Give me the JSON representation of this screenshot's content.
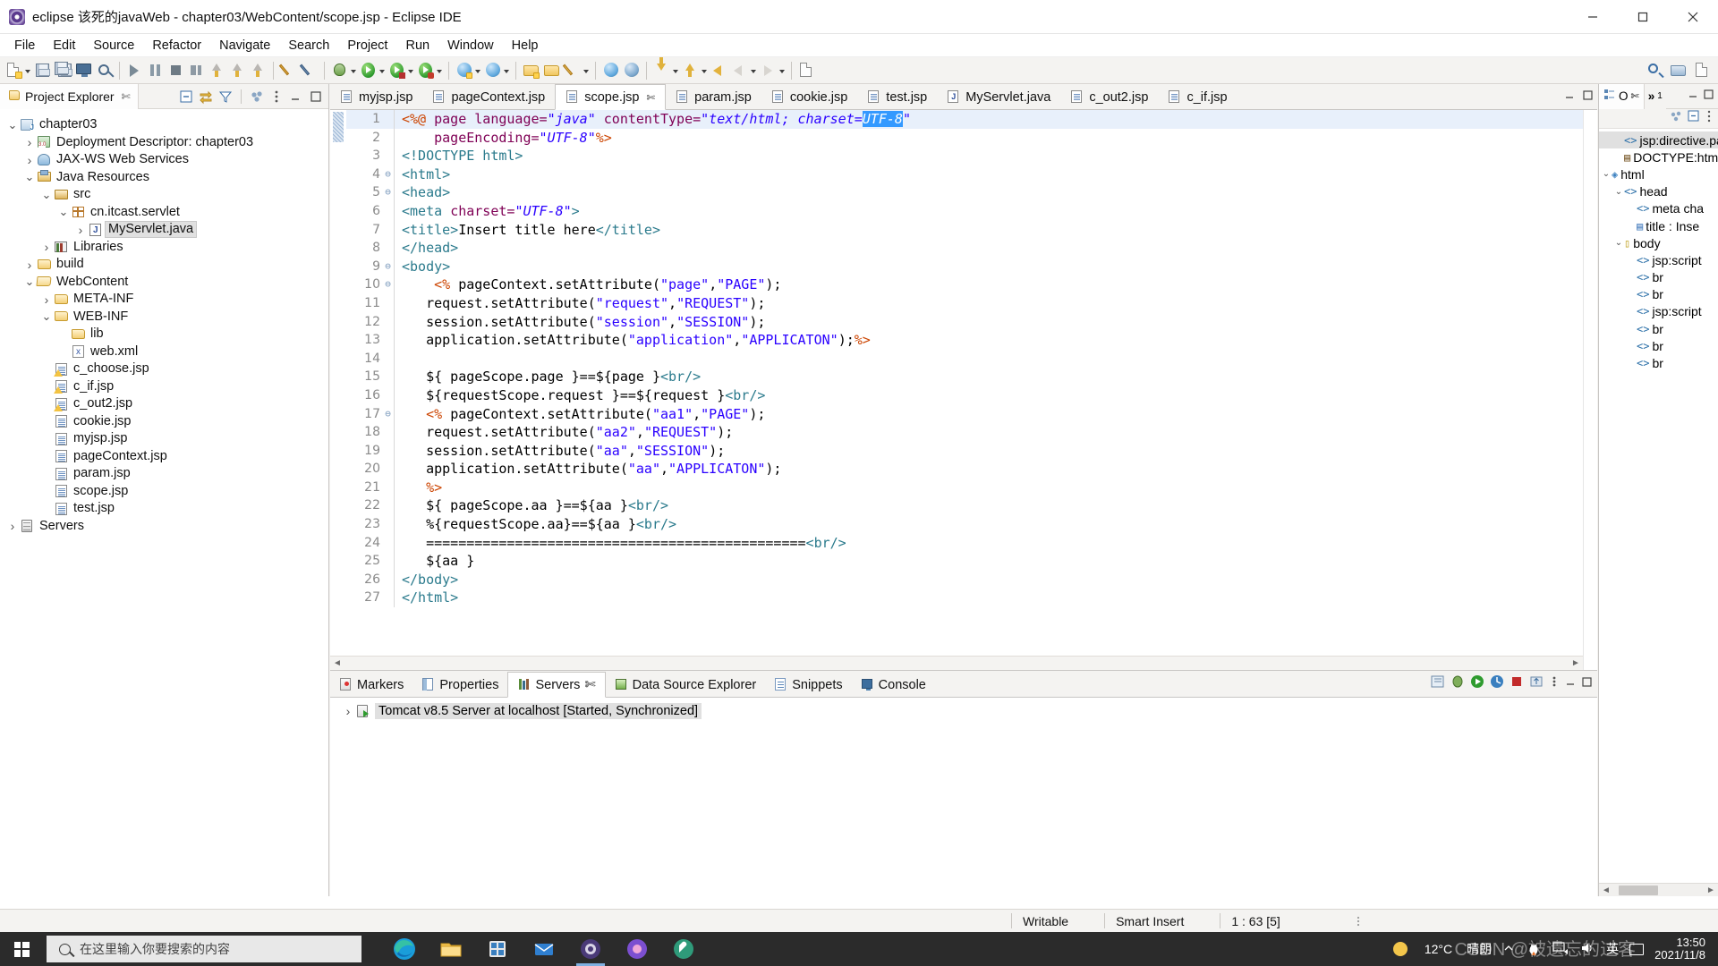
{
  "window": {
    "title": "eclipse 该死的javaWeb - chapter03/WebContent/scope.jsp - Eclipse IDE",
    "app_icon": "eclipse-icon",
    "minimize": "minimize-button",
    "maximize": "maximize-button",
    "close": "close-button"
  },
  "menubar": {
    "items": [
      {
        "label": "File"
      },
      {
        "label": "Edit"
      },
      {
        "label": "Source"
      },
      {
        "label": "Refactor"
      },
      {
        "label": "Navigate"
      },
      {
        "label": "Search"
      },
      {
        "label": "Project"
      },
      {
        "label": "Run"
      },
      {
        "label": "Window"
      },
      {
        "label": "Help"
      }
    ]
  },
  "project_explorer": {
    "tab_label": "Project Explorer",
    "close_glyph": "✄",
    "tree": [
      {
        "label": "chapter03",
        "indent": 0,
        "chevron": "v",
        "icon": "java-project-icon",
        "selected": false
      },
      {
        "label": "Deployment Descriptor: chapter03",
        "indent": 1,
        "chevron": ">",
        "icon": "deployment-descriptor-icon",
        "selected": false
      },
      {
        "label": "JAX-WS Web Services",
        "indent": 1,
        "chevron": ">",
        "icon": "jax-ws-icon",
        "selected": false
      },
      {
        "label": "Java Resources",
        "indent": 1,
        "chevron": "v",
        "icon": "java-resources-icon",
        "selected": false
      },
      {
        "label": "src",
        "indent": 2,
        "chevron": "v",
        "icon": "source-folder-icon",
        "selected": false
      },
      {
        "label": "cn.itcast.servlet",
        "indent": 3,
        "chevron": "v",
        "icon": "package-icon",
        "selected": false
      },
      {
        "label": "MyServlet.java",
        "indent": 4,
        "chevron": ">",
        "icon": "java-file-icon",
        "selected": true
      },
      {
        "label": "Libraries",
        "indent": 2,
        "chevron": ">",
        "icon": "libraries-icon",
        "selected": false
      },
      {
        "label": "build",
        "indent": 1,
        "chevron": ">",
        "icon": "folder-icon",
        "selected": false
      },
      {
        "label": "WebContent",
        "indent": 1,
        "chevron": "v",
        "icon": "folder-open-icon",
        "selected": false
      },
      {
        "label": "META-INF",
        "indent": 2,
        "chevron": ">",
        "icon": "folder-icon",
        "selected": false
      },
      {
        "label": "WEB-INF",
        "indent": 2,
        "chevron": "v",
        "icon": "folder-icon",
        "selected": false
      },
      {
        "label": "lib",
        "indent": 3,
        "chevron": "",
        "icon": "folder-icon",
        "selected": false
      },
      {
        "label": "web.xml",
        "indent": 3,
        "chevron": "",
        "icon": "xml-file-icon",
        "selected": false
      },
      {
        "label": "c_choose.jsp",
        "indent": 2,
        "chevron": "",
        "icon": "jsp-warning-icon",
        "selected": false
      },
      {
        "label": "c_if.jsp",
        "indent": 2,
        "chevron": "",
        "icon": "jsp-warning-icon",
        "selected": false
      },
      {
        "label": "c_out2.jsp",
        "indent": 2,
        "chevron": "",
        "icon": "jsp-warning-icon",
        "selected": false
      },
      {
        "label": "cookie.jsp",
        "indent": 2,
        "chevron": "",
        "icon": "jsp-file-icon",
        "selected": false
      },
      {
        "label": "myjsp.jsp",
        "indent": 2,
        "chevron": "",
        "icon": "jsp-file-icon",
        "selected": false
      },
      {
        "label": "pageContext.jsp",
        "indent": 2,
        "chevron": "",
        "icon": "jsp-file-icon",
        "selected": false
      },
      {
        "label": "param.jsp",
        "indent": 2,
        "chevron": "",
        "icon": "jsp-file-icon",
        "selected": false
      },
      {
        "label": "scope.jsp",
        "indent": 2,
        "chevron": "",
        "icon": "jsp-file-icon",
        "selected": false
      },
      {
        "label": "test.jsp",
        "indent": 2,
        "chevron": "",
        "icon": "jsp-file-icon",
        "selected": false
      },
      {
        "label": "Servers",
        "indent": 0,
        "chevron": ">",
        "icon": "servers-icon",
        "selected": false
      }
    ]
  },
  "editor": {
    "tabs": [
      {
        "label": "myjsp.jsp",
        "icon": "jsp-file-icon",
        "active": false,
        "closable": false
      },
      {
        "label": "pageContext.jsp",
        "icon": "jsp-file-icon",
        "active": false,
        "closable": false
      },
      {
        "label": "scope.jsp",
        "icon": "jsp-file-icon",
        "active": true,
        "closable": true
      },
      {
        "label": "param.jsp",
        "icon": "jsp-file-icon",
        "active": false,
        "closable": false
      },
      {
        "label": "cookie.jsp",
        "icon": "jsp-file-icon",
        "active": false,
        "closable": false
      },
      {
        "label": "test.jsp",
        "icon": "jsp-file-icon",
        "active": false,
        "closable": false
      },
      {
        "label": "MyServlet.java",
        "icon": "java-file-icon",
        "active": false,
        "closable": false
      },
      {
        "label": "c_out2.jsp",
        "icon": "jsp-file-icon",
        "active": false,
        "closable": false
      },
      {
        "label": "c_if.jsp",
        "icon": "jsp-file-icon",
        "active": false,
        "closable": false
      }
    ],
    "close_glyph": "✄",
    "lines": [
      {
        "n": 1,
        "fold": "",
        "highlight": true,
        "tokens": [
          {
            "t": "<%@ ",
            "c": "red"
          },
          {
            "t": "page ",
            "c": "dir"
          },
          {
            "t": "language=",
            "c": "attr"
          },
          {
            "t": "\"java\"",
            "c": "str"
          },
          {
            "t": " ",
            "c": "pl"
          },
          {
            "t": "contentType=",
            "c": "attr"
          },
          {
            "t": "\"text/html; charset=",
            "c": "str"
          },
          {
            "t": "UTF-8",
            "c": "sel"
          },
          {
            "t": "\"",
            "c": "str"
          }
        ]
      },
      {
        "n": 2,
        "fold": "",
        "tokens": [
          {
            "t": "    ",
            "c": "pl"
          },
          {
            "t": "pageEncoding=",
            "c": "attr"
          },
          {
            "t": "\"UTF-8\"",
            "c": "str"
          },
          {
            "t": "%>",
            "c": "red"
          }
        ]
      },
      {
        "n": 3,
        "fold": "",
        "tokens": [
          {
            "t": "<!DOCTYPE html>",
            "c": "tag"
          }
        ]
      },
      {
        "n": 4,
        "fold": "⊖",
        "tokens": [
          {
            "t": "<html>",
            "c": "tag"
          }
        ]
      },
      {
        "n": 5,
        "fold": "⊖",
        "tokens": [
          {
            "t": "<head>",
            "c": "tag"
          }
        ]
      },
      {
        "n": 6,
        "fold": "",
        "tokens": [
          {
            "t": "<meta ",
            "c": "tag"
          },
          {
            "t": "charset=",
            "c": "attr"
          },
          {
            "t": "\"UTF-8\"",
            "c": "str"
          },
          {
            "t": ">",
            "c": "tag"
          }
        ]
      },
      {
        "n": 7,
        "fold": "",
        "tokens": [
          {
            "t": "<title>",
            "c": "tag"
          },
          {
            "t": "Insert title here",
            "c": "pl"
          },
          {
            "t": "</title>",
            "c": "tag"
          }
        ]
      },
      {
        "n": 8,
        "fold": "",
        "tokens": [
          {
            "t": "</head>",
            "c": "tag"
          }
        ]
      },
      {
        "n": 9,
        "fold": "⊖",
        "tokens": [
          {
            "t": "<body>",
            "c": "tag"
          }
        ]
      },
      {
        "n": 10,
        "fold": "⊖",
        "tokens": [
          {
            "t": "    ",
            "c": "pl"
          },
          {
            "t": "<% ",
            "c": "red"
          },
          {
            "t": "pageContext.setAttribute(",
            "c": "pl"
          },
          {
            "t": "\"page\"",
            "c": "strp"
          },
          {
            "t": ",",
            "c": "pl"
          },
          {
            "t": "\"PAGE\"",
            "c": "strp"
          },
          {
            "t": ");",
            "c": "pl"
          }
        ]
      },
      {
        "n": 11,
        "fold": "",
        "tokens": [
          {
            "t": "   ",
            "c": "pl"
          },
          {
            "t": "request.setAttribute(",
            "c": "pl"
          },
          {
            "t": "\"request\"",
            "c": "strp"
          },
          {
            "t": ",",
            "c": "pl"
          },
          {
            "t": "\"REQUEST\"",
            "c": "strp"
          },
          {
            "t": ");",
            "c": "pl"
          }
        ]
      },
      {
        "n": 12,
        "fold": "",
        "tokens": [
          {
            "t": "   ",
            "c": "pl"
          },
          {
            "t": "session.setAttribute(",
            "c": "pl"
          },
          {
            "t": "\"session\"",
            "c": "strp"
          },
          {
            "t": ",",
            "c": "pl"
          },
          {
            "t": "\"SESSION\"",
            "c": "strp"
          },
          {
            "t": ");",
            "c": "pl"
          }
        ]
      },
      {
        "n": 13,
        "fold": "",
        "tokens": [
          {
            "t": "   ",
            "c": "pl"
          },
          {
            "t": "application.setAttribute(",
            "c": "pl"
          },
          {
            "t": "\"application\"",
            "c": "strp"
          },
          {
            "t": ",",
            "c": "pl"
          },
          {
            "t": "\"APPLICATON\"",
            "c": "strp"
          },
          {
            "t": ");",
            "c": "pl"
          },
          {
            "t": "%>",
            "c": "red"
          }
        ]
      },
      {
        "n": 14,
        "fold": "",
        "tokens": [
          {
            "t": "",
            "c": "pl"
          }
        ]
      },
      {
        "n": 15,
        "fold": "",
        "tokens": [
          {
            "t": "   ",
            "c": "pl"
          },
          {
            "t": "${ pageScope.page }==${page }",
            "c": "pl"
          },
          {
            "t": "<br/>",
            "c": "tag"
          }
        ]
      },
      {
        "n": 16,
        "fold": "",
        "tokens": [
          {
            "t": "   ",
            "c": "pl"
          },
          {
            "t": "${requestScope.request }==${request }",
            "c": "pl"
          },
          {
            "t": "<br/>",
            "c": "tag"
          }
        ]
      },
      {
        "n": 17,
        "fold": "⊖",
        "tokens": [
          {
            "t": "   ",
            "c": "pl"
          },
          {
            "t": "<% ",
            "c": "red"
          },
          {
            "t": "pageContext.setAttribute(",
            "c": "pl"
          },
          {
            "t": "\"aa1\"",
            "c": "strp"
          },
          {
            "t": ",",
            "c": "pl"
          },
          {
            "t": "\"PAGE\"",
            "c": "strp"
          },
          {
            "t": ");",
            "c": "pl"
          }
        ]
      },
      {
        "n": 18,
        "fold": "",
        "tokens": [
          {
            "t": "   ",
            "c": "pl"
          },
          {
            "t": "request.setAttribute(",
            "c": "pl"
          },
          {
            "t": "\"aa2\"",
            "c": "strp"
          },
          {
            "t": ",",
            "c": "pl"
          },
          {
            "t": "\"REQUEST\"",
            "c": "strp"
          },
          {
            "t": ");",
            "c": "pl"
          }
        ]
      },
      {
        "n": 19,
        "fold": "",
        "tokens": [
          {
            "t": "   ",
            "c": "pl"
          },
          {
            "t": "session.setAttribute(",
            "c": "pl"
          },
          {
            "t": "\"aa\"",
            "c": "strp"
          },
          {
            "t": ",",
            "c": "pl"
          },
          {
            "t": "\"SESSION\"",
            "c": "strp"
          },
          {
            "t": ");",
            "c": "pl"
          }
        ]
      },
      {
        "n": 20,
        "fold": "",
        "tokens": [
          {
            "t": "   ",
            "c": "pl"
          },
          {
            "t": "application.setAttribute(",
            "c": "pl"
          },
          {
            "t": "\"aa\"",
            "c": "strp"
          },
          {
            "t": ",",
            "c": "pl"
          },
          {
            "t": "\"APPLICATON\"",
            "c": "strp"
          },
          {
            "t": ");",
            "c": "pl"
          }
        ]
      },
      {
        "n": 21,
        "fold": "",
        "tokens": [
          {
            "t": "   ",
            "c": "pl"
          },
          {
            "t": "%>",
            "c": "red"
          }
        ]
      },
      {
        "n": 22,
        "fold": "",
        "tokens": [
          {
            "t": "   ",
            "c": "pl"
          },
          {
            "t": "${ pageScope.aa }==${aa }",
            "c": "pl"
          },
          {
            "t": "<br/>",
            "c": "tag"
          }
        ]
      },
      {
        "n": 23,
        "fold": "",
        "tokens": [
          {
            "t": "   ",
            "c": "pl"
          },
          {
            "t": "%{requestScope.aa}==${aa }",
            "c": "pl"
          },
          {
            "t": "<br/>",
            "c": "tag"
          }
        ]
      },
      {
        "n": 24,
        "fold": "",
        "tokens": [
          {
            "t": "   ",
            "c": "pl"
          },
          {
            "t": "===============================================",
            "c": "pl"
          },
          {
            "t": "<br/>",
            "c": "tag"
          }
        ]
      },
      {
        "n": 25,
        "fold": "",
        "tokens": [
          {
            "t": "   ",
            "c": "pl"
          },
          {
            "t": "${aa }",
            "c": "pl"
          }
        ]
      },
      {
        "n": 26,
        "fold": "",
        "tokens": [
          {
            "t": "</body>",
            "c": "tag"
          }
        ]
      },
      {
        "n": 27,
        "fold": "",
        "tokens": [
          {
            "t": "</html>",
            "c": "tag"
          }
        ]
      }
    ]
  },
  "bottom_panel": {
    "tabs": [
      {
        "label": "Markers",
        "icon": "markers-icon",
        "active": false,
        "closable": false
      },
      {
        "label": "Properties",
        "icon": "properties-icon",
        "active": false,
        "closable": false
      },
      {
        "label": "Servers",
        "icon": "servers-icon",
        "active": true,
        "closable": true
      },
      {
        "label": "Data Source Explorer",
        "icon": "data-source-explorer-icon",
        "active": false,
        "closable": false
      },
      {
        "label": "Snippets",
        "icon": "snippets-icon",
        "active": false,
        "closable": false
      },
      {
        "label": "Console",
        "icon": "console-icon",
        "active": false,
        "closable": false
      }
    ],
    "close_glyph": "✄",
    "rows": [
      {
        "chevron": ">",
        "icon": "tomcat-server-icon",
        "label": "Tomcat v8.5 Server at localhost  [Started, Synchronized]"
      }
    ]
  },
  "outline": {
    "tab_label": "O",
    "tab_icon": "outline-icon",
    "close_glyph": "✄",
    "overflow_label": "»",
    "overflow_count": "1",
    "items": [
      {
        "label": "jsp:directive.pa",
        "icon": "element-icon",
        "indent": 1,
        "chevron": "",
        "selected": true
      },
      {
        "label": "DOCTYPE:html",
        "icon": "doctype-icon",
        "indent": 1,
        "chevron": "",
        "selected": false
      },
      {
        "label": "html",
        "icon": "html-icon",
        "indent": 0,
        "chevron": "v",
        "selected": false
      },
      {
        "label": "head",
        "icon": "element-icon",
        "indent": 1,
        "chevron": "v",
        "selected": false
      },
      {
        "label": "meta cha",
        "icon": "element-icon",
        "indent": 2,
        "chevron": "",
        "selected": false
      },
      {
        "label": "title : Inse",
        "icon": "title-icon",
        "indent": 2,
        "chevron": "",
        "selected": false
      },
      {
        "label": "body",
        "icon": "body-icon",
        "indent": 1,
        "chevron": "v",
        "selected": false
      },
      {
        "label": "jsp:script",
        "icon": "element-icon",
        "indent": 2,
        "chevron": "",
        "selected": false
      },
      {
        "label": "br",
        "icon": "element-icon",
        "indent": 2,
        "chevron": "",
        "selected": false
      },
      {
        "label": "br",
        "icon": "element-icon",
        "indent": 2,
        "chevron": "",
        "selected": false
      },
      {
        "label": "jsp:script",
        "icon": "element-icon",
        "indent": 2,
        "chevron": "",
        "selected": false
      },
      {
        "label": "br",
        "icon": "element-icon",
        "indent": 2,
        "chevron": "",
        "selected": false
      },
      {
        "label": "br",
        "icon": "element-icon",
        "indent": 2,
        "chevron": "",
        "selected": false
      },
      {
        "label": "br",
        "icon": "element-icon",
        "indent": 2,
        "chevron": "",
        "selected": false
      }
    ]
  },
  "statusbar": {
    "writable": "Writable",
    "insert_mode": "Smart Insert",
    "position": "1 : 63 [5]"
  },
  "taskbar": {
    "search_placeholder": "在这里输入你要搜索的内容",
    "apps": [
      {
        "name": "edge-icon"
      },
      {
        "name": "file-explorer-icon"
      },
      {
        "name": "store-icon"
      },
      {
        "name": "mail-icon"
      },
      {
        "name": "eclipse-icon"
      },
      {
        "name": "media-icon"
      },
      {
        "name": "tool-icon"
      }
    ],
    "weather_temp": "12°C",
    "weather_desc": "晴朗",
    "ime_label": "英",
    "time": "13:50",
    "date": "2021/11/8",
    "watermark": "CSDN @被遗忘的过客"
  },
  "colors": {
    "accent": "#3399ff",
    "tab_active_bg": "#ffffff",
    "chrome_bg": "#f4f3f1",
    "selection_blue": "#e8f0fb",
    "taskbar_bg": "#2b2b2b"
  }
}
